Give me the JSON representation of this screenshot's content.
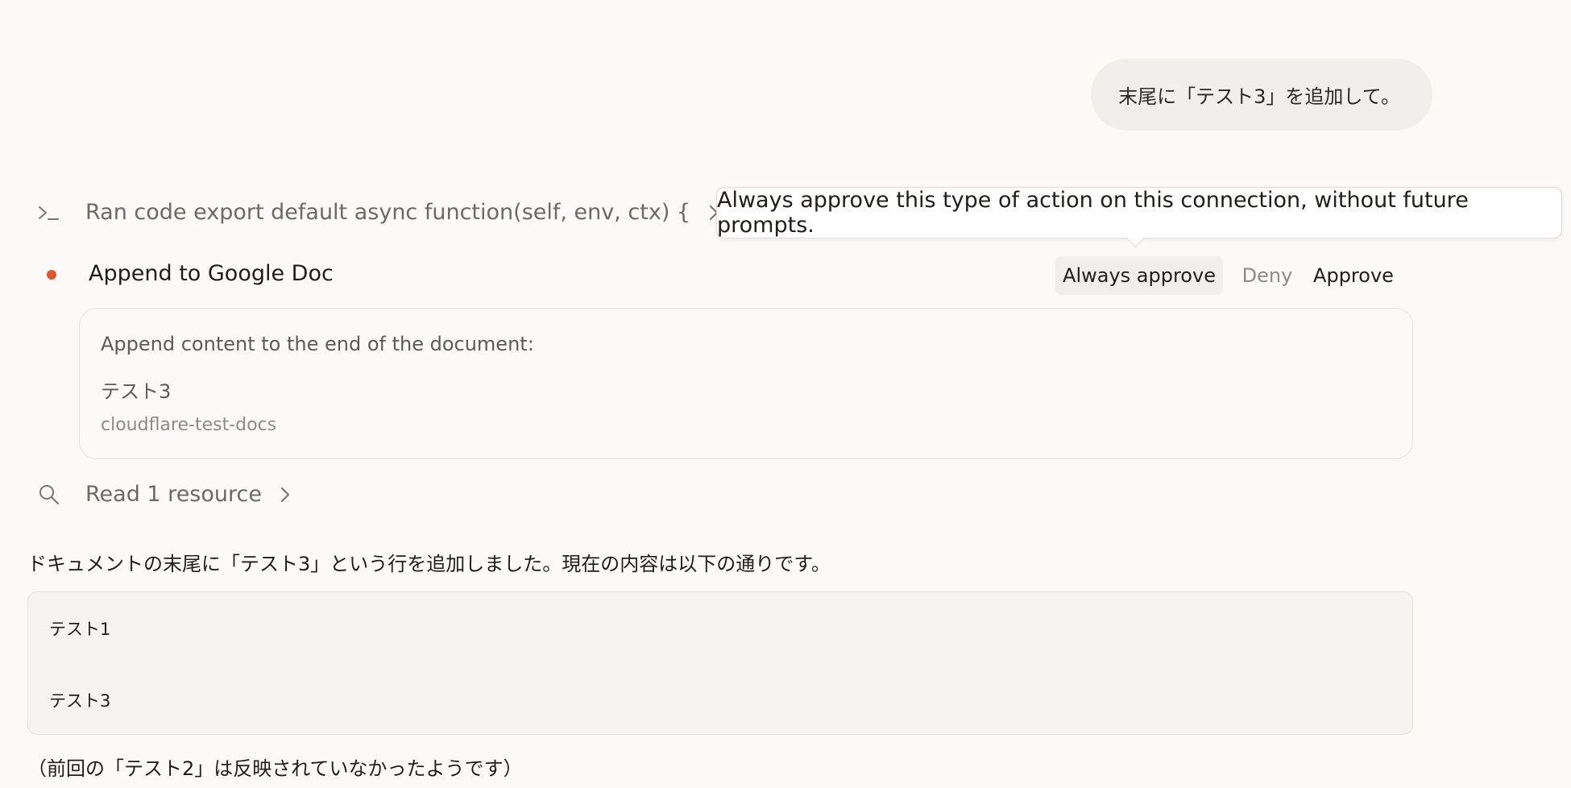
{
  "user_message": "末尾に「テスト3」を追加して。",
  "ran_code": {
    "label": "Ran code export default async function(self, env, ctx) {",
    "icon": "terminal-icon"
  },
  "tooltip": {
    "text": "Always approve this type of action on this connection, without future prompts."
  },
  "approval": {
    "title": "Append to Google Doc",
    "status_color": "#e2562e",
    "buttons": {
      "always": "Always approve",
      "deny": "Deny",
      "approve": "Approve"
    }
  },
  "detail": {
    "description": "Append content to the end of the document:",
    "content": "テスト3",
    "document": "cloudflare-test-docs"
  },
  "read_resource": {
    "label": "Read 1 resource",
    "icon": "search-icon"
  },
  "response": {
    "text": "ドキュメントの末尾に「テスト3」という行を追加しました。現在の内容は以下の通りです。",
    "code_lines": [
      "テスト1",
      "テスト3"
    ],
    "footnote": "（前回の「テスト2」は反映されていなかったようです）"
  }
}
